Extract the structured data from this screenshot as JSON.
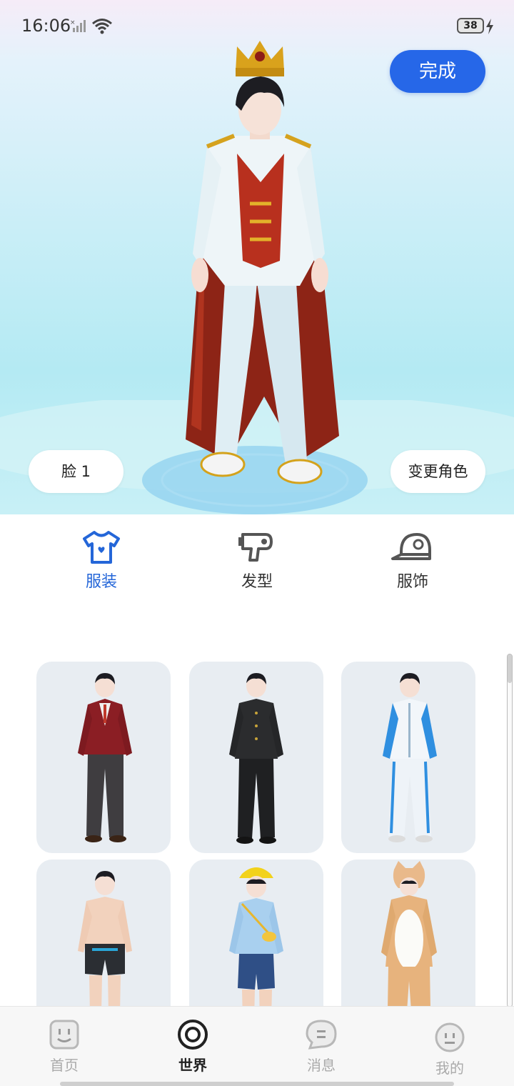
{
  "status_bar": {
    "time": "16:06",
    "battery": "38"
  },
  "preview": {
    "done_label": "完成",
    "face_label": "脸 1",
    "change_role_label": "变更角色"
  },
  "tabs": [
    {
      "label": "服装",
      "icon": "tshirt-icon",
      "active": true
    },
    {
      "label": "发型",
      "icon": "hairdryer-icon",
      "active": false
    },
    {
      "label": "服饰",
      "icon": "cap-icon",
      "active": false
    }
  ],
  "outfits": [
    {
      "name": "blazer-uniform"
    },
    {
      "name": "black-gakuran"
    },
    {
      "name": "blue-tracksuit"
    },
    {
      "name": "swimwear"
    },
    {
      "name": "kindergarten-uniform"
    },
    {
      "name": "cat-costume"
    }
  ],
  "bottom_nav": [
    {
      "label": "首页",
      "icon": "home-icon",
      "active": false
    },
    {
      "label": "世界",
      "icon": "world-icon",
      "active": true
    },
    {
      "label": "消息",
      "icon": "message-icon",
      "active": false
    },
    {
      "label": "我的",
      "icon": "profile-icon",
      "active": false
    }
  ],
  "colors": {
    "accent": "#2667e8",
    "tab_active": "#2466d8",
    "card_bg": "#e8edf2"
  }
}
